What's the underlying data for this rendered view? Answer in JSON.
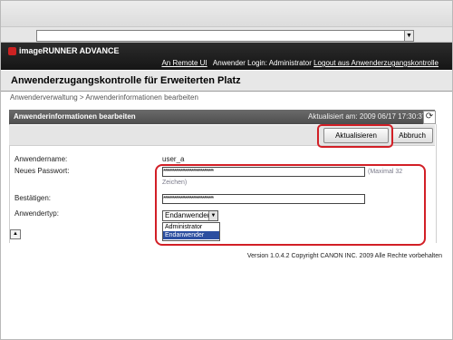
{
  "header": {
    "app_title": "imageRUNNER ADVANCE",
    "links": {
      "remote_ui": "An Remote UI",
      "login_text": "Anwender Login: Administrator",
      "logout": "Logout aus Anwenderzugangskontrolle"
    }
  },
  "page": {
    "title": "Anwenderzugangskontrolle für Erweiterten Platz",
    "breadcrumb": "Anwenderverwaltung > Anwenderinformationen bearbeiten"
  },
  "panel": {
    "title": "Anwenderinformationen bearbeiten",
    "updated": "Aktualisiert am: 2009 06/17 17:30:37",
    "buttons": {
      "update": "Aktualisieren",
      "cancel": "Abbruch"
    }
  },
  "form": {
    "username_label": "Anwendername:",
    "username_value": "user_a",
    "new_password_label": "Neues Passwort:",
    "new_password_value": "********************************",
    "new_password_hint_1": "(Maximal 32",
    "new_password_hint_2": "Zeichen)",
    "confirm_label": "Bestätigen:",
    "confirm_value": "********************************",
    "user_type_label": "Anwendertyp:",
    "user_type_selected": "Endanwender",
    "user_type_options": [
      "Administrator",
      "Endanwender"
    ]
  },
  "footer": {
    "copyright": "Version 1.0.4.2 Copyright CANON INC. 2009 Alle Rechte vorbehalten"
  },
  "colors": {
    "highlight": "#d21f26",
    "banner": "#1e1e1e",
    "selected_option": "#2b4ea0"
  }
}
